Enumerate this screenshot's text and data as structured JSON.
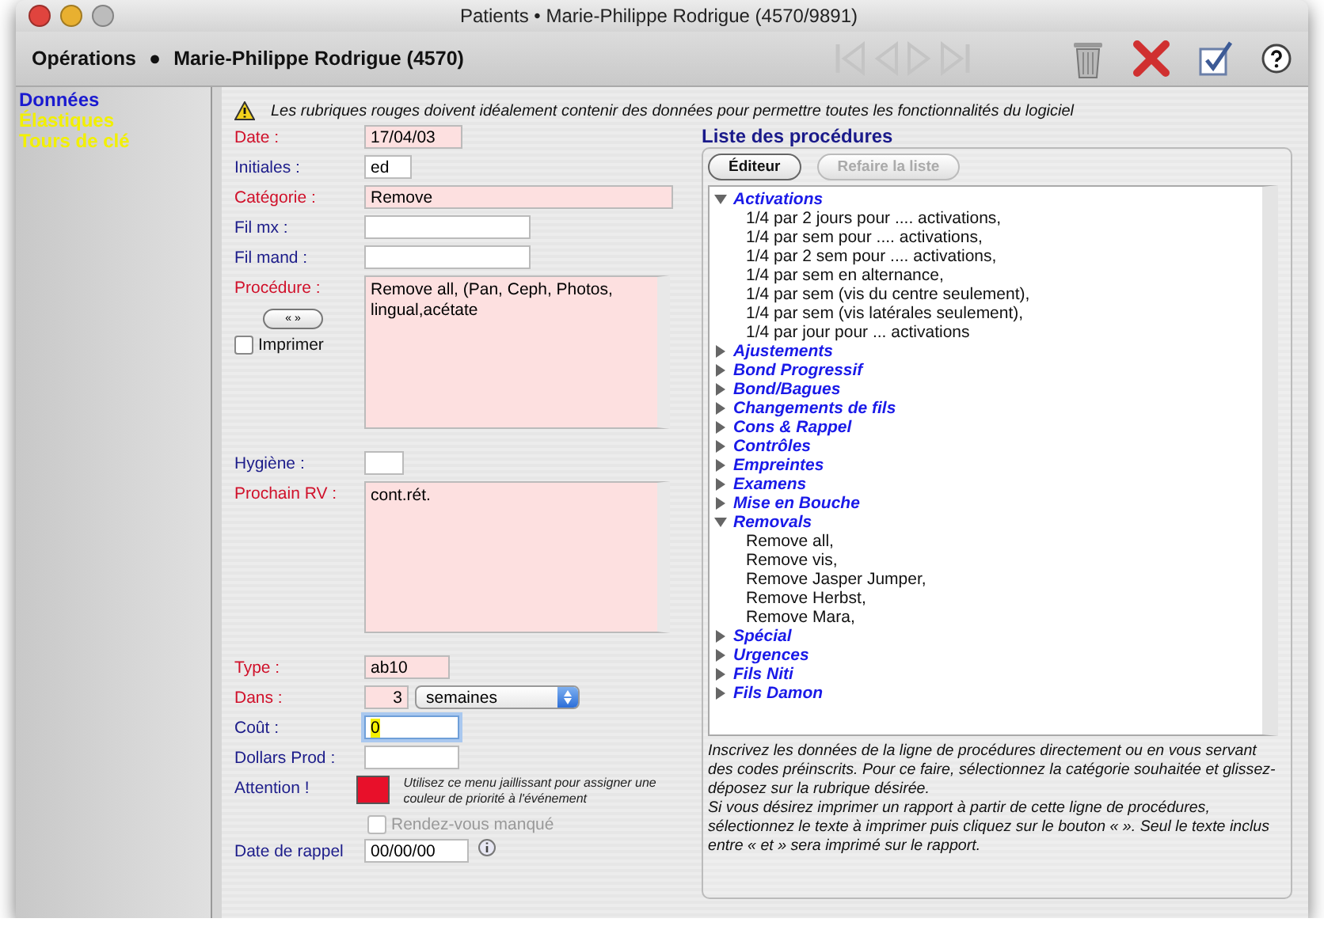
{
  "window": {
    "title": "Patients • Marie-Philippe Rodrigue (4570/9891)"
  },
  "header": {
    "section": "Opérations",
    "separator": "●",
    "patient": "Marie-Philippe Rodrigue (4570)"
  },
  "toolbar": [
    {
      "kind": "first",
      "disabled": true
    },
    {
      "kind": "previous",
      "disabled": true
    },
    {
      "kind": "next",
      "disabled": true
    },
    {
      "kind": "last",
      "disabled": true
    },
    {
      "kind": "delete",
      "disabled": false
    },
    {
      "kind": "cancel",
      "disabled": false
    },
    {
      "kind": "validate",
      "disabled": false
    },
    {
      "kind": "help",
      "disabled": false
    }
  ],
  "sidebar": {
    "items": [
      {
        "label": "Données",
        "selected": true
      },
      {
        "label": "Élastiques",
        "selected": false
      },
      {
        "label": "Tours de clé",
        "selected": false
      }
    ]
  },
  "warning": "Les rubriques rouges doivent idéalement contenir des données pour permettre toutes les fonctionnalités du logiciel",
  "form": [
    {
      "kind": "text",
      "label": "Date :",
      "required": true,
      "value": "17/04/03"
    },
    {
      "kind": "text",
      "label": "Initiales :",
      "required": false,
      "value": "ed"
    },
    {
      "kind": "text",
      "label": "Catégorie :",
      "required": true,
      "value": "Remove"
    },
    {
      "kind": "text",
      "label": "Fil mx :",
      "required": false
    },
    {
      "kind": "text",
      "label": "Fil mand :",
      "required": false
    },
    {
      "kind": "textarea",
      "label": "Procédure :",
      "required": true,
      "value": "Remove all, (Pan, Ceph, Photos, lingual,acétate",
      "button": "« »",
      "checkbox": {
        "label": "Imprimer",
        "checked": false
      }
    },
    {
      "kind": "text",
      "label": "Hygiène :",
      "required": false
    },
    {
      "kind": "textarea",
      "label": "Prochain RV :",
      "required": true,
      "value": "cont.rét."
    },
    {
      "kind": "text",
      "label": "Type :",
      "required": true,
      "value": "ab10"
    },
    {
      "kind": "select",
      "label": "Dans :",
      "required": true,
      "value": "3",
      "option": "semaines"
    },
    {
      "kind": "text",
      "label": "Coût :",
      "required": false,
      "value": "0",
      "focused": true
    },
    {
      "kind": "text",
      "label": "Dollars Prod :",
      "required": false
    },
    {
      "kind": "color",
      "label": "Attention !",
      "required": false,
      "color": "#e8102a",
      "note": "Utilisez ce menu jaillissant pour assigner une couleur de priorité à l'événement"
    },
    {
      "kind": "checkbox",
      "label": "Rendez-vous manqué",
      "checked": false,
      "disabled": true
    },
    {
      "kind": "date",
      "label": "Date de rappel",
      "required": false,
      "value": "00/00/00"
    }
  ],
  "procedures": {
    "title": "Liste des procédures",
    "buttons": [
      {
        "label": "Éditeur",
        "disabled": false
      },
      {
        "label": "Refaire la liste",
        "disabled": true
      }
    ],
    "tree": [
      {
        "label": "Activations",
        "expanded": true,
        "children": [
          {
            "label": "1/4 par 2 jours pour .... activations,"
          },
          {
            "label": "1/4 par sem pour .... activations,"
          },
          {
            "label": "1/4 par 2 sem pour .... activations,"
          },
          {
            "label": "1/4 par sem en alternance,"
          },
          {
            "label": "1/4 par sem (vis du centre seulement),"
          },
          {
            "label": "1/4 par sem (vis latérales seulement),"
          },
          {
            "label": "1/4 par jour pour ... activations"
          }
        ]
      },
      {
        "label": "Ajustements",
        "expanded": false
      },
      {
        "label": "Bond Progressif",
        "expanded": false
      },
      {
        "label": "Bond/Bagues",
        "expanded": false
      },
      {
        "label": "Changements de fils",
        "expanded": false
      },
      {
        "label": "Cons & Rappel",
        "expanded": false
      },
      {
        "label": "Contrôles",
        "expanded": false
      },
      {
        "label": "Empreintes",
        "expanded": false
      },
      {
        "label": "Examens",
        "expanded": false
      },
      {
        "label": "Mise en Bouche",
        "expanded": false
      },
      {
        "label": "Removals",
        "expanded": true,
        "children": [
          {
            "label": "Remove all,"
          },
          {
            "label": "Remove vis,"
          },
          {
            "label": "Remove Jasper Jumper,"
          },
          {
            "label": "Remove Herbst,"
          },
          {
            "label": "Remove Mara,"
          }
        ]
      },
      {
        "label": "Spécial",
        "expanded": false
      },
      {
        "label": "Urgences",
        "expanded": false
      },
      {
        "label": "Fils Niti",
        "expanded": false
      },
      {
        "label": "Fils Damon",
        "expanded": false
      }
    ],
    "help": [
      "Inscrivez les données de la ligne de procédures directement ou en vous servant des codes préinscrits. Pour ce faire, sélectionnez la catégorie souhaitée et glissez-déposez sur la rubrique désirée.",
      "Si vous désirez imprimer un rapport à partir de cette ligne de procédures, sélectionnez le texte à imprimer puis cliquez sur le bouton « ». Seul le texte inclus entre « et » sera imprimé sur le rapport."
    ]
  }
}
